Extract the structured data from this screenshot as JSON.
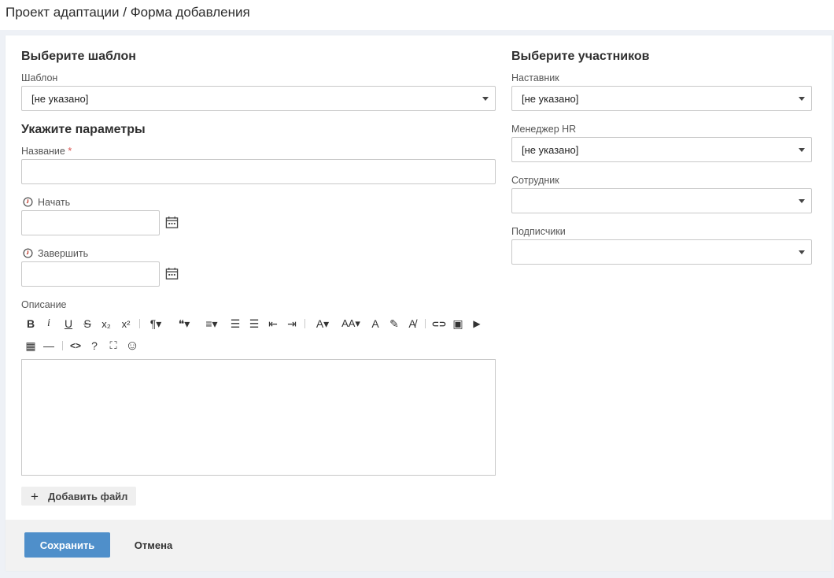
{
  "page": {
    "title": "Проект адаптации / Форма добавления"
  },
  "template_section": {
    "heading": "Выберите шаблон",
    "field_label": "Шаблон",
    "value": "[не указано]"
  },
  "params_section": {
    "heading": "Укажите параметры",
    "name_label": "Название",
    "name_required_mark": "*",
    "name_value": "",
    "start_label": "Начать",
    "start_value": "",
    "end_label": "Завершить",
    "end_value": "",
    "description_label": "Описание"
  },
  "participants_section": {
    "heading": "Выберите участников",
    "mentor_label": "Наставник",
    "mentor_value": "[не указано]",
    "hr_label": "Менеджер HR",
    "hr_value": "[не указано]",
    "employee_label": "Сотрудник",
    "employee_value": "",
    "subscribers_label": "Подписчики",
    "subscribers_value": ""
  },
  "editor_toolbar": {
    "row1": [
      {
        "icon": "bold-icon",
        "glyph": "B"
      },
      {
        "icon": "italic-icon",
        "glyph": "i"
      },
      {
        "icon": "underline-icon",
        "glyph": "U"
      },
      {
        "icon": "strikethrough-icon",
        "glyph": "S"
      },
      {
        "icon": "subscript-icon",
        "glyph": "x₂"
      },
      {
        "icon": "superscript-icon",
        "glyph": "x²"
      },
      {
        "icon": "paragraph-format-icon",
        "glyph": "¶▾"
      },
      {
        "icon": "quote-icon",
        "glyph": "❝▾"
      },
      {
        "icon": "align-icon",
        "glyph": "≡▾"
      },
      {
        "icon": "ordered-list-icon",
        "glyph": "☰"
      },
      {
        "icon": "unordered-list-icon",
        "glyph": "☰"
      },
      {
        "icon": "outdent-icon",
        "glyph": "⇤"
      },
      {
        "icon": "indent-icon",
        "glyph": "⇥"
      },
      {
        "icon": "font-family-icon",
        "glyph": "A▾"
      },
      {
        "icon": "font-size-icon",
        "glyph": "AA▾"
      },
      {
        "icon": "text-color-icon",
        "glyph": "A"
      },
      {
        "icon": "highlight-icon",
        "glyph": "✎"
      },
      {
        "icon": "clear-format-icon",
        "glyph": "A̸"
      },
      {
        "icon": "link-icon",
        "glyph": "⊂⊃"
      },
      {
        "icon": "image-icon",
        "glyph": "▣"
      },
      {
        "icon": "video-icon",
        "glyph": "▶"
      }
    ],
    "row2": [
      {
        "icon": "table-icon",
        "glyph": "▦"
      },
      {
        "icon": "horizontal-line-icon",
        "glyph": "—"
      },
      {
        "icon": "code-view-icon",
        "glyph": "<>"
      },
      {
        "icon": "help-icon",
        "glyph": "?"
      },
      {
        "icon": "fullscreen-icon",
        "glyph": "⛶"
      },
      {
        "icon": "emoji-icon",
        "glyph": "☺"
      }
    ]
  },
  "attachments": {
    "add_file_label": "Добавить файл"
  },
  "footer": {
    "save_label": "Сохранить",
    "cancel_label": "Отмена"
  },
  "colors": {
    "primary_button": "#4f8fca",
    "required": "#d9534f",
    "background": "#eef1f6"
  }
}
